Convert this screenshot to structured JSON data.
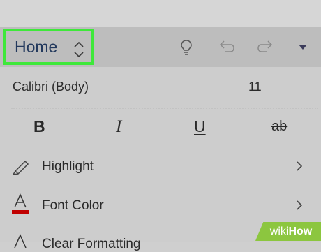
{
  "ribbon": {
    "tab_label": "Home",
    "toolbar_icons": [
      "lightbulb-icon",
      "undo-icon",
      "redo-icon",
      "dropdown-triangle-icon"
    ]
  },
  "font": {
    "name": "Calibri (Body)",
    "size": "11"
  },
  "styles": {
    "bold": "B",
    "italic": "I",
    "underline": "U",
    "strikethrough": "ab"
  },
  "menu": {
    "highlight": "Highlight",
    "font_color": "Font Color",
    "clear_formatting": "Clear Formatting"
  },
  "colors": {
    "highlight_border": "#3ee83a",
    "tab_text": "#23395d",
    "font_color_bar": "#c00000"
  },
  "watermark": {
    "wiki": "wiki",
    "how": "How"
  }
}
